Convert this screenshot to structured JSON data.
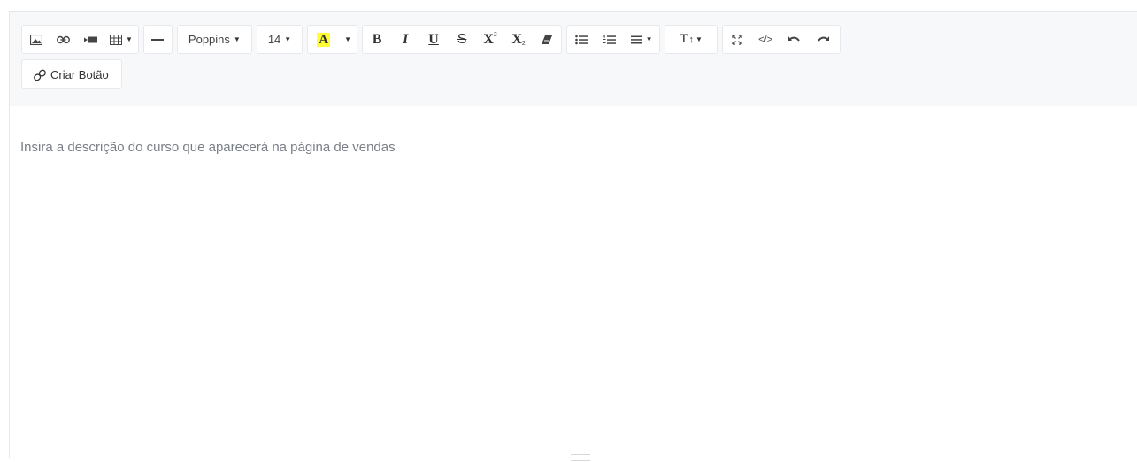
{
  "toolbar": {
    "font_family": "Poppins",
    "font_size": "14",
    "color_letter": "A",
    "bold_glyph": "B",
    "italic_glyph": "I",
    "underline_glyph": "U",
    "strike_glyph": "S",
    "superscript_glyph": "X",
    "superscript_mark": "2",
    "subscript_glyph": "X",
    "subscript_mark": "2",
    "codeview_glyph": "</>",
    "height_glyph": "T",
    "criar_botao_label": "Criar Botão",
    "highlight_color": "#ffff33"
  },
  "content": {
    "placeholder": "Insira a descrição do curso que aparecerá na página de vendas"
  }
}
